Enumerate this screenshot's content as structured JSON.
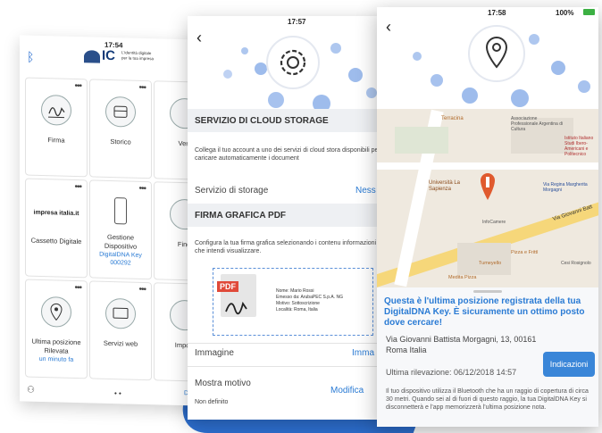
{
  "phone1": {
    "status_time": "17:54",
    "logo_text": "IC",
    "logo_tagline": "L'identità digitale per la tua impresa",
    "tiles": [
      {
        "label": "Firma"
      },
      {
        "label": "Storico"
      },
      {
        "label": "Verif"
      },
      {
        "label": "Cassetto Digitale",
        "brand": "impresa italia.it"
      },
      {
        "label": "Gestione Dispositivo",
        "sub": "DigitalDNA Key 000292"
      },
      {
        "label": "Findi"
      },
      {
        "label": "Ultima posizione Rilevata",
        "sub": "un minuto fa"
      },
      {
        "label": "Servizi web"
      },
      {
        "label": "Impost"
      }
    ],
    "bottom_right": "Digi"
  },
  "phone2": {
    "status_time": "17:57",
    "section_cloud_title": "SERVIZIO DI CLOUD STORAGE",
    "section_cloud_desc": "Collega il tuo account a uno dei servizi di cloud stora disponibili per caricare automaticamente i document",
    "storage_label": "Servizio di storage",
    "storage_value": "Ness",
    "section_sign_title": "FIRMA GRAFICA PDF",
    "section_sign_desc": "Configura la tua firma grafica selezionando i contenu informazioni che intendi visualizzare.",
    "pdf_badge": "PDF",
    "sig_info": [
      "Nome: Mario Rossi",
      "Emesso da: ArubaPEC S.p.A. NG",
      "Motivo: Sottoscrizione",
      "Località: Roma, Italia"
    ],
    "image_label": "Immagine",
    "image_value": "Imma",
    "motivo_label": "Mostra motivo",
    "motivo_value": "Modifica",
    "motivo_sub": "Non definito"
  },
  "phone3": {
    "status_time": "17:58",
    "battery": "100%",
    "map_labels": {
      "terracina": "Terracina",
      "assoc": "Associazione Professionale Argentina di Cultura",
      "istituto": "Istituto Italiano Studi Ibero-Americani e Politecnico",
      "univ": "Università La Sapienza",
      "regina": "Via Regina Margherita Morgagni",
      "infocamere": "InfoCamere",
      "street": "Via Giovanni Batt",
      "pizza": "Pizza e Frittì",
      "mediapizza": "Medita Pizza",
      "tumeyo": "Tumeyello",
      "cesi": "Cesi Rosignolo"
    },
    "info_title": "Questa è l'ultima posizione registrata della tua DigitalDNA Key.  È sicuramente un ottimo posto dove cercare!",
    "address": "Via Giovanni Battista Morgagni, 13, 00161 Roma Italia",
    "last_seen": "Ultima rilevazione: 06/12/2018 14:57",
    "directions": "Indicazioni",
    "footer_text": "Il tuo dispositivo utilizza il Bluetooth che ha un raggio di copertura di circa 30 metri. Quando sei al di fuori di questo raggio, la tua DigitalDNA Key si disconnetterà e l'app memorizzerà l'ultima posizione nota."
  },
  "colors": {
    "accent": "#2a7bd4",
    "pdf_red": "#e04a3a",
    "pin_red": "#e05a2e"
  }
}
